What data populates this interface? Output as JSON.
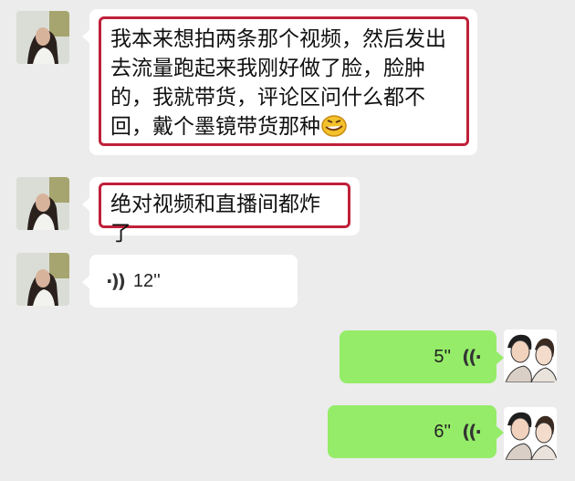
{
  "messages": [
    {
      "side": "left",
      "kind": "text",
      "lines": [
        "我本来想拍两条那个视频，然后发出",
        "去流量跑起来我刚好做了脸，脸肿",
        "的，我就带货，评论区问什么都不",
        "回，戴个墨镜带货那种"
      ],
      "emoji": "grimace-laugh-emoji"
    },
    {
      "side": "left",
      "kind": "text",
      "lines": [
        "绝对视频和直播间都炸了"
      ]
    },
    {
      "side": "left",
      "kind": "voice",
      "duration": "12''"
    },
    {
      "side": "right",
      "kind": "voice",
      "duration": "5''"
    },
    {
      "side": "right",
      "kind": "voice",
      "duration": "6''"
    }
  ],
  "colors": {
    "background": "#ececec",
    "bubble_in": "#ffffff",
    "bubble_out": "#95ec69",
    "highlight_border": "#c0203a"
  }
}
